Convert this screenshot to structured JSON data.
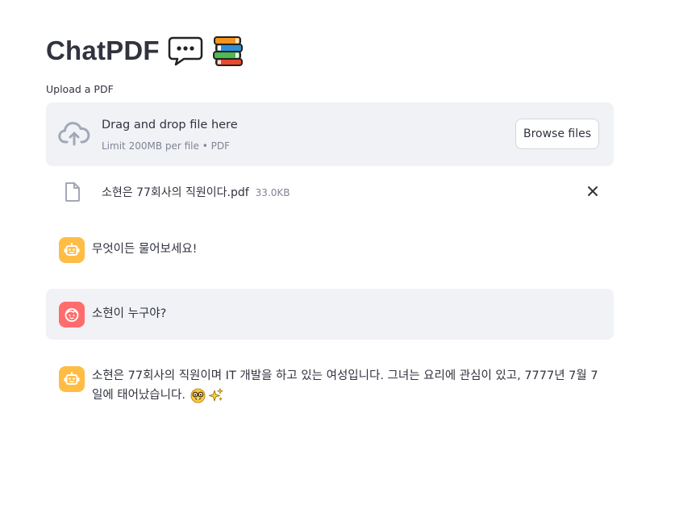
{
  "header": {
    "title": "ChatPDF",
    "emojis": [
      "speech-balloon-icon",
      "books-icon"
    ]
  },
  "uploader": {
    "label": "Upload a PDF",
    "drop_title": "Drag and drop file here",
    "limit_text": "Limit 200MB per file • PDF",
    "browse_label": "Browse files",
    "icon": "cloud-upload-icon"
  },
  "uploaded_file": {
    "name": "소현은 77회사의 직원이다.pdf",
    "size": "33.0KB",
    "icon": "file-icon",
    "remove_icon": "close-icon"
  },
  "chat": {
    "messages": [
      {
        "role": "assistant",
        "text": "무엇이든 물어보세요!"
      },
      {
        "role": "user",
        "text": "소현이 누구야?"
      },
      {
        "role": "assistant",
        "line1": "소현은 77회사의 직원이며 IT 개발을 하고 있는 여성입니다. 그녀는 요리에 관심이 있고, 7777년 7월 7",
        "line2": "일에 태어났습니다.",
        "emojis": [
          "nerd-face-icon",
          "sparkles-icon"
        ]
      }
    ]
  },
  "colors": {
    "accent_bot": "#ffbd45",
    "accent_user": "#ff6c6c",
    "panel_bg": "#f0f2f6",
    "text": "#31333f"
  }
}
